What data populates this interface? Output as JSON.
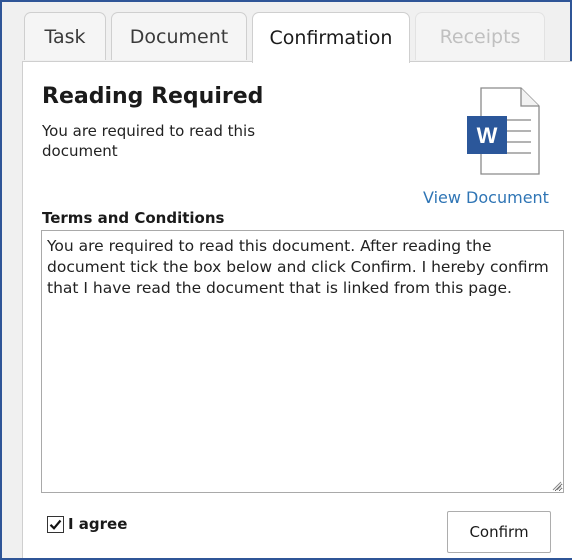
{
  "tabs": [
    {
      "label": "Task",
      "state": "normal"
    },
    {
      "label": "Document",
      "state": "normal"
    },
    {
      "label": "Confirmation",
      "state": "active"
    },
    {
      "label": "Receipts",
      "state": "disabled"
    }
  ],
  "main": {
    "heading": "Reading Required",
    "subtext": "You are required to read this document",
    "doc_icon": "word-document-icon",
    "doc_icon_letter": "W",
    "view_document_label": "View Document",
    "terms_label": "Terms and Conditions",
    "terms_text": "You are required to read this document. After reading the document tick the box below and click Confirm. I hereby confirm that I have read the document that is linked from this page.",
    "agree_label": "I agree",
    "agree_checked": true,
    "confirm_label": "Confirm"
  },
  "colors": {
    "frame_border": "#2f5597",
    "link": "#2f75b5",
    "word_blue": "#2b579a"
  }
}
